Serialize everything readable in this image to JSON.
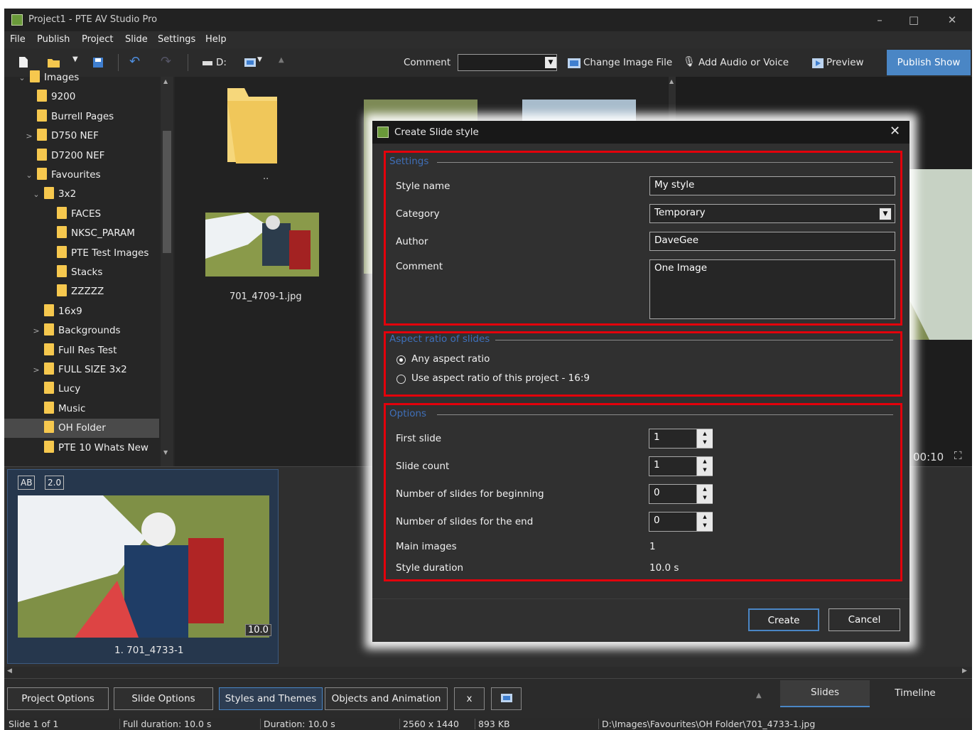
{
  "window": {
    "title": "Project1 - PTE AV Studio Pro",
    "controls": [
      "–",
      "□",
      "✕"
    ]
  },
  "menu": [
    "File",
    "Publish",
    "Project",
    "Slide",
    "Settings",
    "Help"
  ],
  "toolbar": {
    "drive": "D:",
    "comment_label": "Comment",
    "comment_value": "",
    "change_image": "Change Image File",
    "add_audio": "Add Audio or Voice",
    "preview": "Preview",
    "publish": "Publish Show"
  },
  "tree": [
    {
      "label": "Images",
      "depth": 1,
      "arrow": "⌄"
    },
    {
      "label": "9200",
      "depth": 2,
      "arrow": ""
    },
    {
      "label": "Burrell Pages",
      "depth": 2,
      "arrow": ""
    },
    {
      "label": "D750 NEF",
      "depth": 2,
      "arrow": ">"
    },
    {
      "label": "D7200 NEF",
      "depth": 2,
      "arrow": ""
    },
    {
      "label": "Favourites",
      "depth": 2,
      "arrow": "⌄"
    },
    {
      "label": "3x2",
      "depth": 3,
      "arrow": "⌄"
    },
    {
      "label": "FACES",
      "depth": 4,
      "arrow": ""
    },
    {
      "label": "NKSC_PARAM",
      "depth": 4,
      "arrow": ""
    },
    {
      "label": "PTE Test Images",
      "depth": 4,
      "arrow": ""
    },
    {
      "label": "Stacks",
      "depth": 4,
      "arrow": ""
    },
    {
      "label": "ZZZZZ",
      "depth": 4,
      "arrow": ""
    },
    {
      "label": "16x9",
      "depth": 3,
      "arrow": ""
    },
    {
      "label": "Backgrounds",
      "depth": 3,
      "arrow": ">"
    },
    {
      "label": "Full Res Test",
      "depth": 3,
      "arrow": ""
    },
    {
      "label": "FULL SIZE 3x2",
      "depth": 3,
      "arrow": ">"
    },
    {
      "label": "Lucy",
      "depth": 3,
      "arrow": ""
    },
    {
      "label": "Music",
      "depth": 3,
      "arrow": ""
    },
    {
      "label": "OH Folder",
      "depth": 3,
      "arrow": "",
      "selected": true
    },
    {
      "label": "PTE 10 Whats New",
      "depth": 3,
      "arrow": ""
    }
  ],
  "browser": {
    "parent_label": "..",
    "file_label": "701_4709-1.jpg"
  },
  "preview_time": "00:10",
  "slide": {
    "badge_ab": "AB",
    "badge_num": "2.0",
    "duration": "10.0",
    "caption": "1. 701_4733-1"
  },
  "bottom_tabs": {
    "project_options": "Project Options",
    "slide_options": "Slide Options",
    "styles": "Styles and Themes",
    "objects": "Objects and Animation",
    "x": "x",
    "slides": "Slides",
    "timeline": "Timeline"
  },
  "status": {
    "slide": "Slide 1 of 1",
    "full": "Full duration: 10.0 s",
    "duration": "Duration: 10.0 s",
    "size": "2560 x 1440",
    "kb": "893 KB",
    "path": "D:\\Images\\Favourites\\OH Folder\\701_4733-1.jpg"
  },
  "dialog": {
    "title": "Create Slide style",
    "settings": {
      "group": "Settings",
      "style_name_label": "Style name",
      "style_name": "My style",
      "category_label": "Category",
      "category": "Temporary",
      "author_label": "Author",
      "author": "DaveGee",
      "comment_label": "Comment",
      "comment": "One Image"
    },
    "aspect": {
      "group": "Aspect ratio of slides",
      "any": "Any aspect ratio",
      "project": "Use aspect ratio of this project - 16:9",
      "selected": "any"
    },
    "options": {
      "group": "Options",
      "first_slide_label": "First slide",
      "first_slide": "1",
      "slide_count_label": "Slide count",
      "slide_count": "1",
      "beginning_label": "Number of slides for beginning",
      "beginning": "0",
      "end_label": "Number of slides for the end",
      "end": "0",
      "main_images_label": "Main images",
      "main_images": "1",
      "duration_label": "Style duration",
      "duration": "10.0 s"
    },
    "create": "Create",
    "cancel": "Cancel"
  },
  "colors": {
    "accent": "#4a86c5",
    "highlight": "#e3000b",
    "group_text": "#3f6fb8",
    "folder": "#f6c84e"
  }
}
